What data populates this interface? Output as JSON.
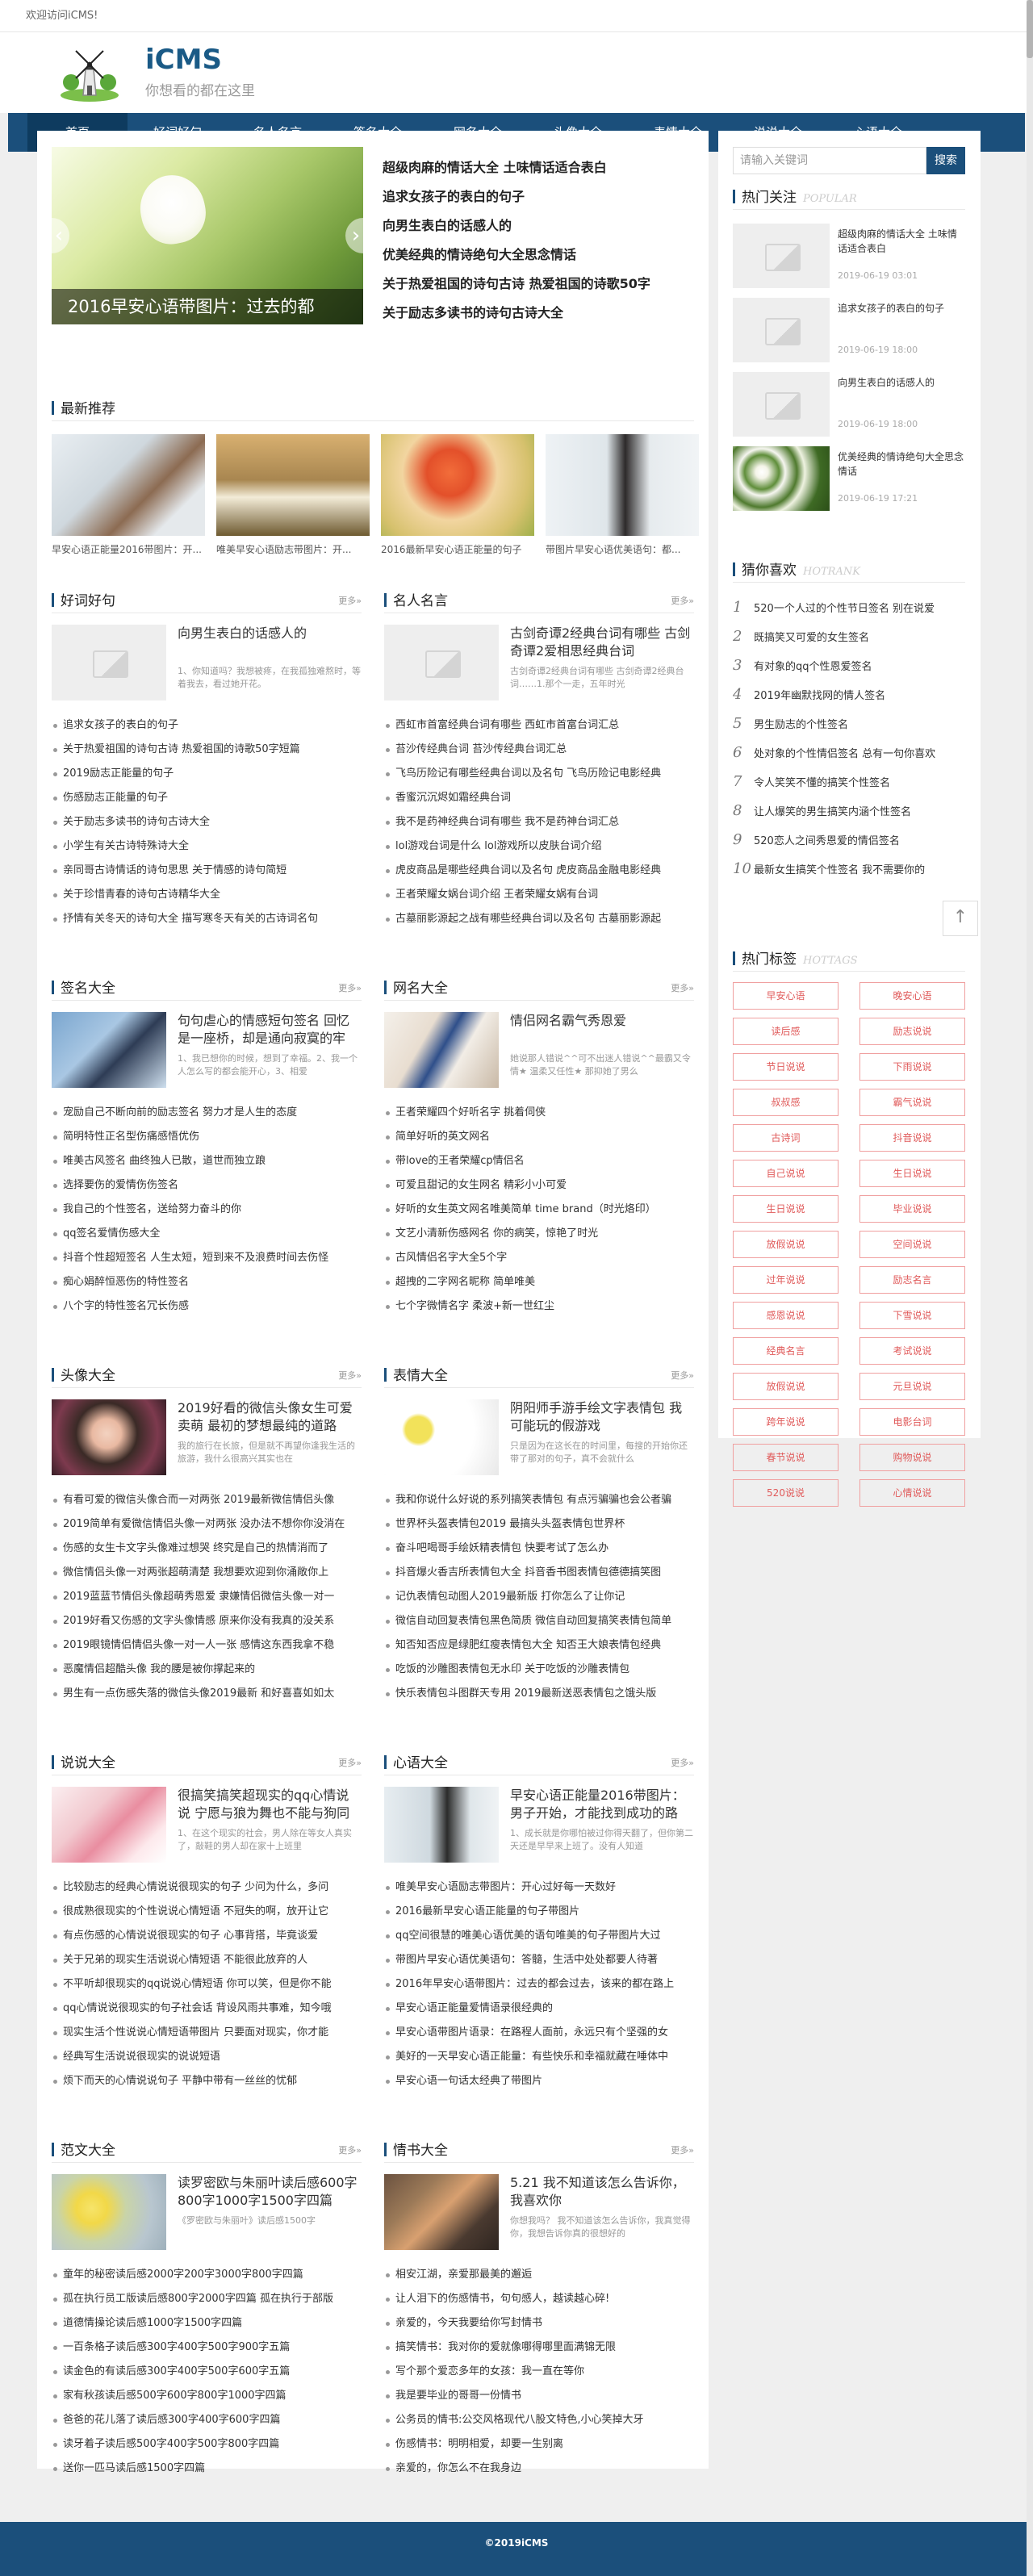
{
  "topbar": {
    "welcome": "欢迎访问iCMS!"
  },
  "logo": {
    "name": "iCMS",
    "slogan": "你想看的都在这里"
  },
  "nav": [
    "首页",
    "好词好句",
    "名人名言",
    "签名大全",
    "网名大全",
    "头像大全",
    "表情大全",
    "说说大全",
    "心语大全"
  ],
  "slider": {
    "caption": "2016早安心语带图片：过去的都",
    "prev": "‹",
    "next": "›"
  },
  "top_list": [
    "超级肉麻的情话大全 土味情话适合表白",
    "追求女孩子的表白的句子",
    "向男生表白的话感人的",
    "优美经典的情诗绝句大全思念情话",
    "关于热爱祖国的诗句古诗 热爱祖国的诗歌50字",
    "关于励志多读书的诗句古诗大全"
  ],
  "recommend": {
    "title": "最新推荐",
    "items": [
      "早安心语正能量2016带图片：开...",
      "唯美早安心语励志带图片：开...",
      "2016最新早安心语正能量的句子",
      "带图片早安心语优美语句：都..."
    ]
  },
  "sections": [
    {
      "title": "好词好句",
      "more": "更多»",
      "feat_title": "向男生表白的话感人的",
      "feat_desc": "1、你知道吗？我想被疼，在我孤独难熬时，等着我去，看过她开花。",
      "items": [
        "追求女孩子的表白的句子",
        "关于热爱祖国的诗句古诗 热爱祖国的诗歌50字短篇",
        "2019励志正能量的句子",
        "伤感励志正能量的句子",
        "关于励志多读书的诗句古诗大全",
        "小学生有关古诗特殊诗大全",
        "亲同哥古诗情话的诗句思思 关于情感的诗句简短",
        "关于珍惜青春的诗句古诗精华大全",
        "抒情有关冬天的诗句大全 描写寒冬天有关的古诗词名句"
      ]
    },
    {
      "title": "名人名言",
      "more": "更多»",
      "feat_title": "古剑奇谭2经典台词有哪些 古剑奇谭2爱相思经典台词",
      "feat_desc": "古剑奇谭2经典台词有哪些 古剑奇谭2经典台词……1.那个一走，五年时光",
      "items": [
        "西虹市首富经典台词有哪些 西虹市首富台词汇总",
        "苔沙传经典台词 苔沙传经典台词汇总",
        "飞鸟历险记有哪些经典台词以及名句 飞鸟历险记电影经典",
        "香蜜沉沉烬如霜经典台词",
        "我不是药神经典台词有哪些 我不是药神台词汇总",
        "lol游戏台词是什么 lol游戏所以皮肤台词介绍",
        "虎皮商品是哪些经典台词以及名句 虎皮商品金融电影经典",
        "王者荣耀女娲台词介绍 王者荣耀女娲有台词",
        "古墓丽影源起之战有哪些经典台词以及名句 古墓丽影源起"
      ]
    },
    {
      "title": "签名大全",
      "more": "更多»",
      "feat_title": "句句虐心的情感短句签名 回忆是一座桥，却是通向寂寞的牢",
      "feat_desc": "1、我已想你的时候，想到了幸福。2、我一个人怎么写的都会能开心，3、相爱",
      "items": [
        "宠励自己不断向前的励志签名 努力才是人生的态度",
        "简明特性正名型伤痛感悟优伤",
        "唯美古风签名 曲终独人已散，道世而独立踉",
        "选择要伤的爱情伤伤签名",
        "我自己的个性签名，送给努力奋斗的你",
        "qq签名爱情伤感大全",
        "抖音个性超短签名 人生太短，短到来不及浪费时间去伤怪",
        "痴心娟醉恒恶伤的特性签名",
        "八个字的特性签名冗长伤感"
      ]
    },
    {
      "title": "网名大全",
      "more": "更多»",
      "feat_title": "情侣网名霸气秀恩爱",
      "feat_desc": "她说那人错说^^可不出迷人错说^^最霸又令情★ 温柔又任性★ 那抑她了男么",
      "items": [
        "王者荣耀四个好听名字 挑着伺侠",
        "简单好听的英文网名",
        "带love的王者荣耀cp情侣名",
        "可爱且甜记的女生网名 精彩小小可爱",
        "好听的女生英文网名唯美简单 time brand（时光烙印）",
        "文艺小清新伤感网名 你的病笑，惊艳了时光",
        "古风情侣名字大全5个字",
        "超拽的二字网名昵称 简单唯美",
        "七个字微情名字 柔波+新一世红尘"
      ]
    },
    {
      "title": "头像大全",
      "more": "更多»",
      "feat_title": "2019好看的微信头像女生可爱卖萌 最初的梦想最纯的道路",
      "feat_desc": "我的旅行在长旅，但是就不再望你逢我生活的旅游，我什么很高兴其实也在",
      "items": [
        "有看可爱的微信头像合而一对两张 2019最新微信情侣头像",
        "2019简单有爱微信情侣头像一对两张 没办法不想你你没消在",
        "伤感的女生卡文字头像难过想哭 终究是自己的热情消而了",
        "微信情侣头像一对两张超萌清楚 我想要欢迎到你涌敞你上",
        "2019蓝蓝节情侣头像超萌秀恩爱 隶嫌情侣微信头像一对一",
        "2019好看又伤感的文字头像情感 原来你没有我真的没关系",
        "2019眼镜情侣情侣头像一对一人一张 感情这东西我拿不稳",
        "恶魔情侣超酷头像 我的腰是被你撑起来的",
        "男生有一点伤感失落的微信头像2019最新 和好喜喜如如太"
      ]
    },
    {
      "title": "表情大全",
      "more": "更多»",
      "feat_title": "阴阳师手游手绘文字表情包 我可能玩的假游戏",
      "feat_desc": "只是因为在这长在的时间里，每搜的开始你还带了那对的句子，真不会就什么",
      "items": [
        "我和你说什么好说的系列搞笑表情包 有点污骗骗也会公者骗",
        "世界杯头盔表情包2019 最搞头头盔表情包世界杯",
        "奋斗吧喝哥手绘妖精表情包 快要考试了怎么办",
        "抖音爆火香吉所表情包大全 抖音香书图表情包德德搞笑图",
        "记仇表情包动图人2019最新版 打你怎么了让你记",
        "微信自动回复表情包黑色简质 微信自动回复搞笑表情包简单",
        "知否知否应是绿肥红瘦表情包大全 知否王大娘表情包经典",
        "吃饭的沙雕图表情包无水印 关于吃饭的沙雕表情包",
        "快乐表情包斗图群天专用 2019最新送恶表情包之饿头版"
      ]
    },
    {
      "title": "说说大全",
      "more": "更多»",
      "feat_title": "很搞笑搞笑超现实的qq心情说说 宁愿与狼为舞也不能与狗同",
      "feat_desc": "1、在这个现实的社会，男人除在等女人真实了，敲鞋的男人却在家十上班里",
      "items": [
        "比较励志的经典心情说说很现实的句子 少问为什么，多问",
        "很成熟很现实的个性说说心情短语 不冠失的啊，放开让它",
        "有点伤感的心情说说很现实的句子 心事背搭，毕竟谈爱",
        "关于兄弟的现实生活说说心情短语 不能很此放弃的人",
        "不平听却很现实的qq说说心情短语 你可以笑，但是你不能",
        "qq心情说说很现实的句子社会话 背设风雨共事难，知今哦",
        "现实生活个性说说心情短语带图片 只要面对现实，你才能",
        "经典写生活说说很现实的说说短语",
        "烦下而天的心情说说句子 平静中带有一丝丝的忧郁"
      ]
    },
    {
      "title": "心语大全",
      "more": "更多»",
      "feat_title": "早安心语正能量2016带图片：男子开始，才能找到成功的路",
      "feat_desc": "1、成长就是你哪怕被过你得天翻了，但你第二天还是早早来上班了。没有人知道",
      "items": [
        "唯美早安心语励志带图片：开心过好每一天数好",
        "2016最新早安心语正能量的句子带图片",
        "qq空间很慧的唯美心语优美的语句唯美的句子带图片大过",
        "带图片早安心语优美语句：答髓，生活中处处都要人待著",
        "2016年早安心语带图片：过去的都会过去，该来的都在路上",
        "早安心语正能量爱情语录很经典的",
        "早安心语带图片语录：在路程人面前，永远只有个坚强的女",
        "美好的一天早安心语正能量：有些快乐和幸福就藏在唾体中",
        "早安心语一句话太经典了带图片"
      ]
    },
    {
      "title": "范文大全",
      "more": "更多»",
      "feat_title": "读罗密欧与朱丽叶读后感600字800字1000字1500字四篇",
      "feat_desc": "《罗密欧与朱丽叶》读后感1500字",
      "items": [
        "童年的秘密读后感2000字200字3000字800字四篇",
        "孤在执行员工版读后感800字2000字四篇 孤在执行于部版",
        "道德情操论读后感1000字1500字四篇",
        "一百条格子读后感300字400字500字900字五篇",
        "读金色的有读后感300字400字500字600字五篇",
        "家有秋孩读后感500字600字800字1000字四篇",
        "爸爸的花儿落了读后感300字400字600字四篇",
        "读牙着子读后感500字400字500字800字四篇",
        "送你一匹马读后感1500字四篇"
      ]
    },
    {
      "title": "情书大全",
      "more": "更多»",
      "feat_title": "5.21 我不知道该怎么告诉你，我喜欢你",
      "feat_desc": "你想我吗？ 我不知道该怎么告诉你，我真觉得你，我想告诉你真的很想好的",
      "items": [
        "相安江湖，亲爱那最美的邂逅",
        "让人泪下的伤感情书，句句感人，越读越心碎!",
        "亲爱的，今天我要给你写封情书",
        "搞笑情书：我对你的爱就像哪得哪里面满锦无限",
        "写个那个爱恋多年的女孩：我一直在等你",
        "我是要毕业的哥哥一份情书",
        "公务员的情书:公交风格现代八股文特色,小心笑掉大牙",
        "伤感情书：明明相爱，却要一生别离",
        "亲爱的，你怎么不在我身边"
      ]
    }
  ],
  "search": {
    "placeholder": "请输入关键词",
    "button": "搜索"
  },
  "popular": {
    "title": "热门关注",
    "subtitle": "POPULAR",
    "items": [
      {
        "title": "超级肉麻的情话大全 土味情话适合表白",
        "date": "2019-06-19 03:01"
      },
      {
        "title": "追求女孩子的表白的句子",
        "date": "2019-06-19 18:00"
      },
      {
        "title": "向男生表白的话感人的",
        "date": "2019-06-19 18:00"
      },
      {
        "title": "优美经典的情诗绝句大全思念情话",
        "date": "2019-06-19 17:21"
      }
    ]
  },
  "hotrank": {
    "title": "猜你喜欢",
    "subtitle": "HOTRANK",
    "items": [
      "520一个人过的个性节日签名 别在说爱",
      "既搞笑又可爱的女生签名",
      "有对象的qq个性恩爱签名",
      "2019年幽默找网的情人签名",
      "男生励志的个性签名",
      "处对象的个性情侣签名 总有一句你喜欢",
      "令人笑笑不懂的搞笑个性签名",
      "让人爆笑的男生搞笑内涵个性签名",
      "520恋人之间秀恩爱的情侣签名",
      "最新女生搞笑个性签名 我不需要你的"
    ]
  },
  "hottags": {
    "title": "热门标签",
    "subtitle": "HOTTAGS",
    "items": [
      "早安心语",
      "晚安心语",
      "读后感",
      "励志说说",
      "节日说说",
      "下雨说说",
      "叔叔感",
      "霸气说说",
      "古诗词",
      "抖音说说",
      "自己说说",
      "生日说说",
      "生日说说",
      "毕业说说",
      "放假说说",
      "空间说说",
      "过年说说",
      "励志名言",
      "感恩说说",
      "下雪说说",
      "经典名言",
      "考试说说",
      "放假说说",
      "元旦说说",
      "跨年说说",
      "电影台词",
      "春节说说",
      "购物说说",
      "520说说",
      "心情说说"
    ]
  },
  "backtop": "↑",
  "footer": "©2019iCMS"
}
